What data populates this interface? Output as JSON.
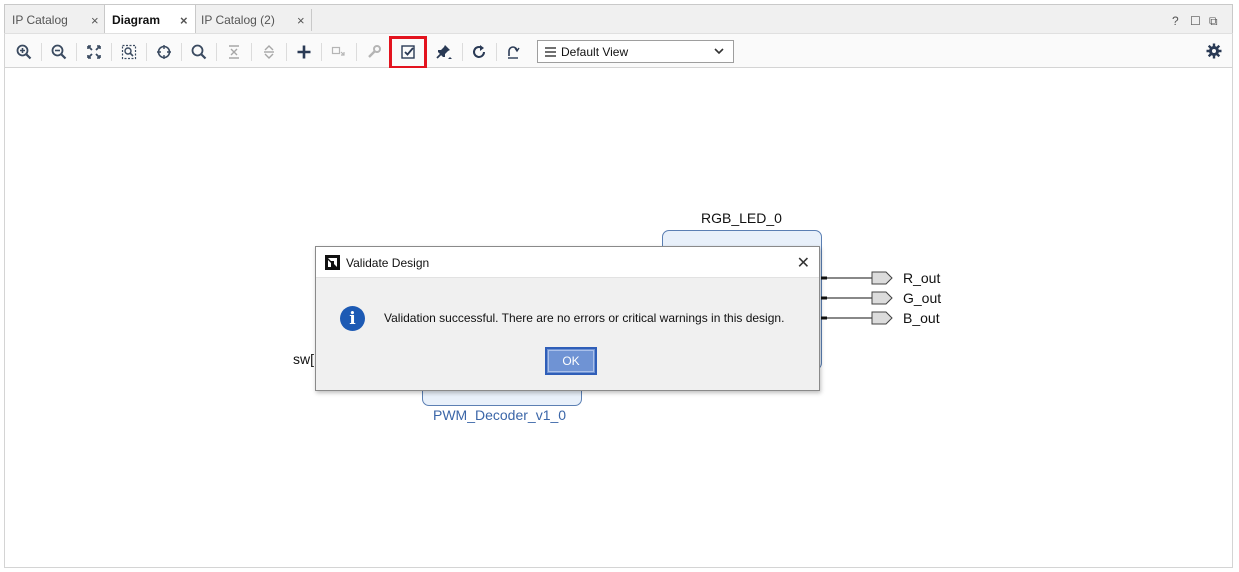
{
  "tabs": [
    {
      "label": "IP Catalog",
      "close": "×"
    },
    {
      "label": "Diagram",
      "close": "×"
    },
    {
      "label": "IP Catalog (2)",
      "close": "×"
    }
  ],
  "window_controls": {
    "help": "?",
    "maximize": "☐",
    "restore": "⧉"
  },
  "toolbar": {
    "view_select": "Default View",
    "icons": [
      "zoom-in-icon",
      "zoom-out-icon",
      "zoom-fit-icon",
      "zoom-area-icon",
      "center-icon",
      "search-icon",
      "collapse-icon",
      "expand-icon",
      "add-ip-icon",
      "add-module-icon",
      "settings-wrench-icon",
      "validate-design-icon",
      "pin-icon",
      "regenerate-icon",
      "optimize-routing-icon",
      "gear-icon"
    ],
    "highlight_color": "#e3131e"
  },
  "diagram": {
    "rgb_led_block": "RGB_LED_0",
    "ports_out": [
      "R_out",
      "G_out",
      "B_out"
    ],
    "sw_label": "sw[",
    "pwm_block": "PWM_Decoder_v1_0",
    "block_color": "#e8f0fa",
    "block_border_color": "#5b7fb3"
  },
  "dialog": {
    "title": "Validate Design",
    "close": "✕",
    "message": "Validation successful. There are no errors or critical warnings in this design.",
    "ok_label": "OK",
    "icon": "info-icon",
    "info_char": "i"
  }
}
